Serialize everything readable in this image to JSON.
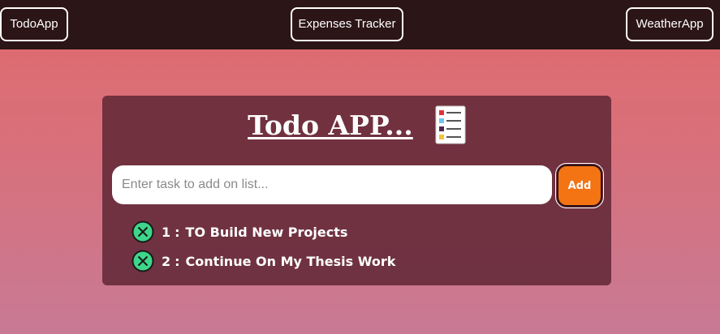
{
  "nav": {
    "todo_label": "TodoApp",
    "expenses_label": "Expenses Tracker",
    "weather_label": "WeatherApp"
  },
  "card": {
    "title": "Todo APP...",
    "title_icon": "clipboard-list-icon"
  },
  "input": {
    "placeholder": "Enter task to add on list...",
    "value": ""
  },
  "add_button": {
    "label": "Add"
  },
  "tasks": [
    {
      "number": "1",
      "separator": ":",
      "text": "TO Build New Projects",
      "icon": "circle-x-icon"
    },
    {
      "number": "2",
      "separator": ":",
      "text": "Continue On My Thesis Work",
      "icon": "circle-x-icon"
    }
  ],
  "colors": {
    "navbar_bg": "#2c1517",
    "card_bg": "#6d3540",
    "add_button_bg": "#f47313",
    "delete_icon_fill": "#3ed68a",
    "gradient_top": "#e06a6d",
    "gradient_bottom": "#c87a95"
  }
}
